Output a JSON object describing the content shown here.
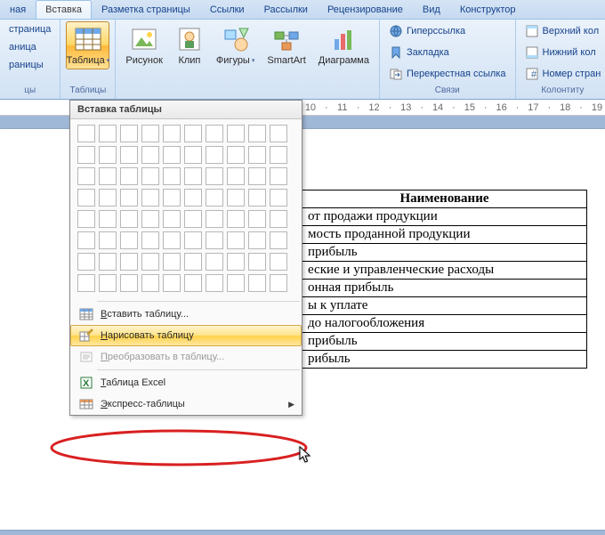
{
  "tabs": {
    "home_partial": "ная",
    "insert": "Вставка",
    "page_layout": "Разметка страницы",
    "references": "Ссылки",
    "mailings": "Рассылки",
    "review": "Рецензирование",
    "view": "Вид",
    "design": "Конструктор"
  },
  "ribbon": {
    "pages_group": {
      "label": "цы",
      "item1": "страница",
      "item2": "аница",
      "item3": "раницы"
    },
    "tables_group": {
      "label": "Таблицы",
      "table_btn": "Таблица"
    },
    "illustrations_group": {
      "picture": "Рисунок",
      "clip": "Клип",
      "shapes": "Фигуры",
      "smartart": "SmartArt",
      "chart": "Диаграмма"
    },
    "links_group": {
      "label": "Связи",
      "hyperlink": "Гиперссылка",
      "bookmark": "Закладка",
      "crossref": "Перекрестная ссылка"
    },
    "headerfooter_group": {
      "label": "Колонтиту",
      "header": "Верхний кол",
      "footer": "Нижний кол",
      "pagenum": "Номер стран"
    }
  },
  "dropdown": {
    "header": "Вставка таблицы",
    "insert_table": "Вставить таблицу...",
    "draw_table": "Нарисовать таблицу",
    "convert": "Преобразовать в таблицу...",
    "excel": "Таблица Excel",
    "quick": "Экспресс-таблицы",
    "insert_u": "В",
    "draw_u": "Н",
    "convert_u": "П",
    "excel_u": "Т",
    "quick_u": "Э"
  },
  "document": {
    "header": "Наименование",
    "rows": [
      "от продажи продукции",
      "мость проданной  продукции",
      "прибыль",
      "еские и управленческие расходы",
      "онная прибыль",
      "ы к уплате",
      " до налогообложения",
      "прибыль",
      "рибыль"
    ]
  },
  "ruler_marks": [
    "10",
    "",
    "11",
    "",
    "12",
    "",
    "13",
    "",
    "14",
    "",
    "15",
    "",
    "16",
    "",
    "17",
    "",
    "18",
    "",
    "19"
  ]
}
